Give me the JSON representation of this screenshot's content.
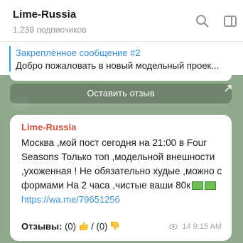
{
  "header": {
    "title": "Lime-Russia",
    "subtitle": "1,238 подписчиков"
  },
  "pinned": {
    "title": "Закреплённое сообщение #2",
    "text": "Добро пожаловать в новый модельный проек..."
  },
  "actions": {
    "comment_button": "Оставить отзыв"
  },
  "message": {
    "sender": "Lime-Russia",
    "body": "Москва ,мой пост сегодня на 21:00 в Four Seasons Только топ ,модельной внешности ,ухоженная ! Не обязательно худые ,можно с формами На 2 часа ,чистые ваши 80к",
    "link": "https://wa.me/7965125б",
    "reactions_label": "Отзывы:",
    "reactions_up": "(0)",
    "reactions_sep": "/",
    "reactions_down": "(0)",
    "views": "14",
    "time": "9:15 AM"
  },
  "colors": {
    "accent": "#3a8fd0",
    "sender": "#c9503d",
    "chat_bg": "#8ea98c"
  },
  "icons": [
    "search-icon",
    "sidebar-toggle-icon",
    "share-icon",
    "eye-icon",
    "thumbs-up-icon",
    "thumbs-down-icon",
    "money-icon"
  ]
}
